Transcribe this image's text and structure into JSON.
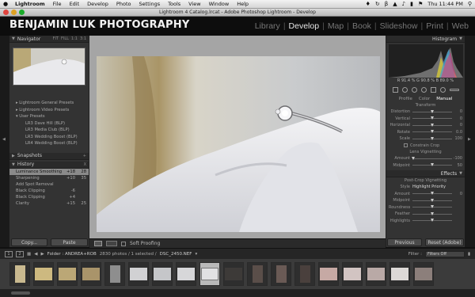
{
  "menubar": {
    "items": [
      "Lightroom",
      "File",
      "Edit",
      "Develop",
      "Photo",
      "Settings",
      "Tools",
      "View",
      "Window",
      "Help"
    ],
    "clock": "Thu 11:44 PM"
  },
  "window": {
    "title": "Lightroom 4 Catalog.lrcat - Adobe Photoshop Lightroom - Develop"
  },
  "identity": {
    "brand": "BENJAMIN LUK PHOTOGRAPHY"
  },
  "modules": [
    "Library",
    "Develop",
    "Map",
    "Book",
    "Slideshow",
    "Print",
    "Web"
  ],
  "navigator": {
    "title": "Navigator",
    "zoom_options": [
      "FIT",
      "FILL",
      "1:1",
      "3:1"
    ]
  },
  "presets": {
    "items": [
      {
        "label": "Lightroom General Presets",
        "level": 1
      },
      {
        "label": "Lightroom Video Presets",
        "level": 1
      },
      {
        "label": "User Presets",
        "level": 1
      },
      {
        "label": "LR3 Dave Hill (BLP)",
        "level": 2
      },
      {
        "label": "LR3 Media Club (BLP)",
        "level": 2
      },
      {
        "label": "LR3 Wedding Boost (BLP)",
        "level": 2
      },
      {
        "label": "LR4 Wedding Boost (BLP)",
        "level": 2
      }
    ]
  },
  "snapshots": {
    "title": "Snapshots",
    "add": "+"
  },
  "history": {
    "title": "History",
    "clear": "X",
    "rows": [
      {
        "label": "Luminance Smoothing",
        "v1": "+18",
        "v2": "28",
        "selected": true
      },
      {
        "label": "Sharpening",
        "v1": "+10",
        "v2": "35"
      },
      {
        "label": "Add Spot Removal",
        "v1": "",
        "v2": ""
      },
      {
        "label": "Black Clipping",
        "v1": "-6",
        "v2": ""
      },
      {
        "label": "Black Clipping",
        "v1": "+4",
        "v2": ""
      },
      {
        "label": "Clarity",
        "v1": "+15",
        "v2": "25"
      }
    ]
  },
  "left_buttons": {
    "copy": "Copy...",
    "paste": "Paste"
  },
  "toolbar": {
    "soft_proofing": "Soft Proofing"
  },
  "histogram": {
    "title": "Histogram",
    "readout": "R  91.4  %  G  90.8  %  B  89.0  %"
  },
  "profile_tabs": {
    "items": [
      "Profile",
      "Color",
      "Manual"
    ],
    "active": "Manual"
  },
  "transform": {
    "label": "Transform",
    "sliders": [
      {
        "label": "Distortion",
        "value": "0",
        "pos": 0.5
      },
      {
        "label": "Vertical",
        "value": "0",
        "pos": 0.5
      },
      {
        "label": "Horizontal",
        "value": "0",
        "pos": 0.5
      },
      {
        "label": "Rotate",
        "value": "0.0",
        "pos": 0.5
      },
      {
        "label": "Scale",
        "value": "100",
        "pos": 0.5
      }
    ],
    "constrain": "Constrain Crop"
  },
  "lens_vignetting": {
    "label": "Lens Vignetting",
    "sliders": [
      {
        "label": "Amount",
        "value": "-100",
        "pos": 0.02
      },
      {
        "label": "Midpoint",
        "value": "50",
        "pos": 0.5
      }
    ]
  },
  "effects": {
    "title": "Effects",
    "label": "Post-Crop Vignetting",
    "style_label": "Style",
    "style_value": "Highlight Priority",
    "sliders": [
      {
        "label": "Amount",
        "value": "0",
        "pos": 0.5
      },
      {
        "label": "Midpoint",
        "value": "",
        "pos": 0.5
      },
      {
        "label": "Roundness",
        "value": "",
        "pos": 0.5
      },
      {
        "label": "Feather",
        "value": "",
        "pos": 0.5
      },
      {
        "label": "Highlights",
        "value": "",
        "pos": 0.5
      }
    ]
  },
  "right_buttons": {
    "previous": "Previous",
    "reset": "Reset (Adobe)"
  },
  "filmstrip_bar": {
    "screen1": "1",
    "screen2": "2",
    "folder": "Folder : ANDREA+ROB",
    "count": "2830 photos / 1 selected /",
    "file": "DSC_2450.NEF",
    "filter_label": "Filter :",
    "filter_value": "Filters Off"
  },
  "colors": {
    "accent": "#e6e6e6",
    "panel": "#333333",
    "background": "#111111"
  }
}
